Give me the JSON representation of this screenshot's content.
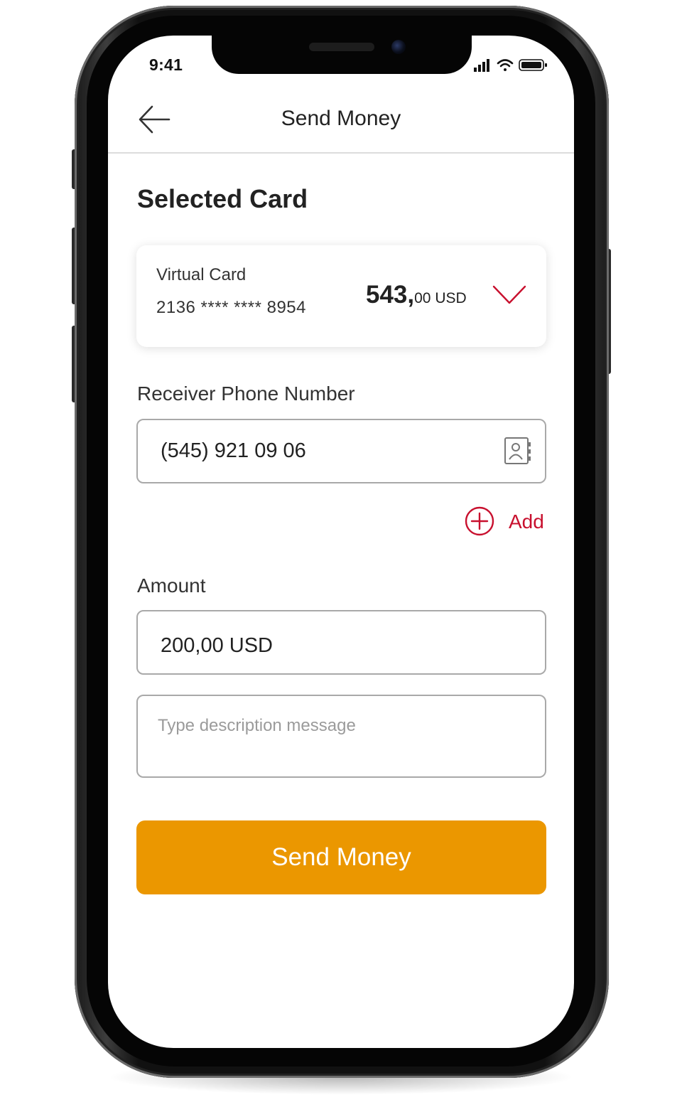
{
  "status_bar": {
    "time": "9:41",
    "icons": [
      "signal-icon",
      "wifi-icon",
      "battery-icon"
    ]
  },
  "header": {
    "title": "Send Money",
    "back_icon": "back-arrow-icon"
  },
  "selected_card": {
    "section_title": "Selected Card",
    "card_name": "Virtual Card",
    "card_number": "2136 **** **** 8954",
    "balance_whole": "543,",
    "balance_fraction": "00 USD",
    "dropdown_icon": "chevron-down-icon"
  },
  "receiver": {
    "label": "Receiver Phone Number",
    "value": "(545) 921 09 06",
    "contact_icon": "contacts-icon"
  },
  "add": {
    "label": "Add",
    "icon": "plus-circle-icon"
  },
  "amount": {
    "label": "Amount",
    "value": "200,00 USD"
  },
  "description": {
    "placeholder": "Type description message"
  },
  "submit": {
    "label": "Send Money"
  },
  "colors": {
    "accent_red": "#c8102e",
    "button_orange": "#eb9700",
    "text_dark": "#222222",
    "border_gray": "#a9a9a9"
  }
}
